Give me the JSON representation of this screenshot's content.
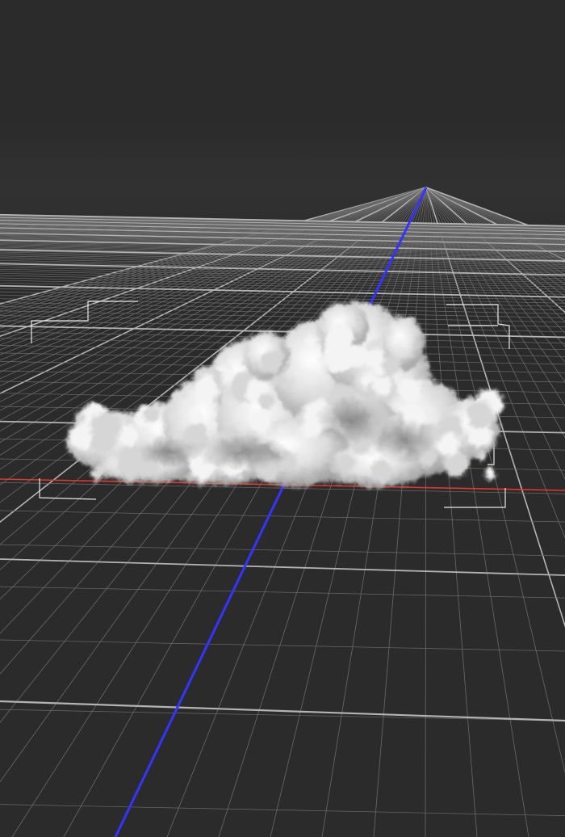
{
  "viewport": {
    "background": "#2b2b2b",
    "horizon_color": "#333333"
  },
  "grid": {
    "line_color": "#6a6a6a",
    "major_line_color": "#b4b4b4",
    "axis_x_color": "#e0362c",
    "axis_z_color": "#3434ff"
  },
  "object": {
    "type": "volumetric-cloud",
    "color": "#f2f2f2",
    "bbox_color": "#e8e8e8"
  }
}
